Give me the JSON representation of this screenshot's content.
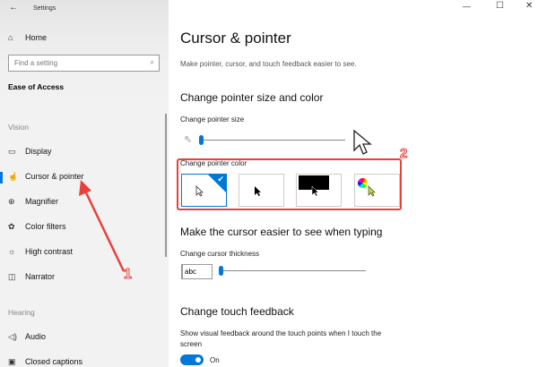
{
  "window": {
    "title": "Settings",
    "minimize": "—",
    "maximize": "☐",
    "close": "✕",
    "back": "←"
  },
  "sidebar": {
    "home": "Home",
    "search_placeholder": "Find a setting",
    "category": "Ease of Access",
    "sections": [
      {
        "label": "Vision",
        "items": [
          {
            "label": "Display",
            "icon": "monitor-icon"
          },
          {
            "label": "Cursor & pointer",
            "icon": "cursor-hand-icon",
            "selected": true
          },
          {
            "label": "Magnifier",
            "icon": "magnifier-icon"
          },
          {
            "label": "Color filters",
            "icon": "palette-icon"
          },
          {
            "label": "High contrast",
            "icon": "sun-icon"
          },
          {
            "label": "Narrator",
            "icon": "narrator-icon"
          }
        ]
      },
      {
        "label": "Hearing",
        "items": [
          {
            "label": "Audio",
            "icon": "speaker-icon"
          },
          {
            "label": "Closed captions",
            "icon": "cc-icon"
          }
        ]
      }
    ]
  },
  "main": {
    "title": "Cursor & pointer",
    "subtitle": "Make pointer, cursor, and touch feedback easier to see.",
    "size_color_heading": "Change pointer size and color",
    "pointer_size_label": "Change pointer size",
    "pointer_size_value": 0.0,
    "pointer_color_label": "Change pointer color",
    "pointer_color_options": [
      "white",
      "black",
      "inverted",
      "custom"
    ],
    "pointer_color_selected": 0,
    "typing_heading": "Make the cursor easier to see when typing",
    "thickness_label": "Change cursor thickness",
    "thickness_preview": "abc",
    "thickness_value": 0.0,
    "touch_heading": "Change touch feedback",
    "touch_label_line1": "Show visual feedback around the touch points when I touch the",
    "touch_label_line2": "screen",
    "touch_toggle": "On"
  },
  "annotations": {
    "arrow1": "1",
    "box2": "2",
    "color": "#e8413c"
  },
  "colors": {
    "accent": "#0078d7"
  }
}
